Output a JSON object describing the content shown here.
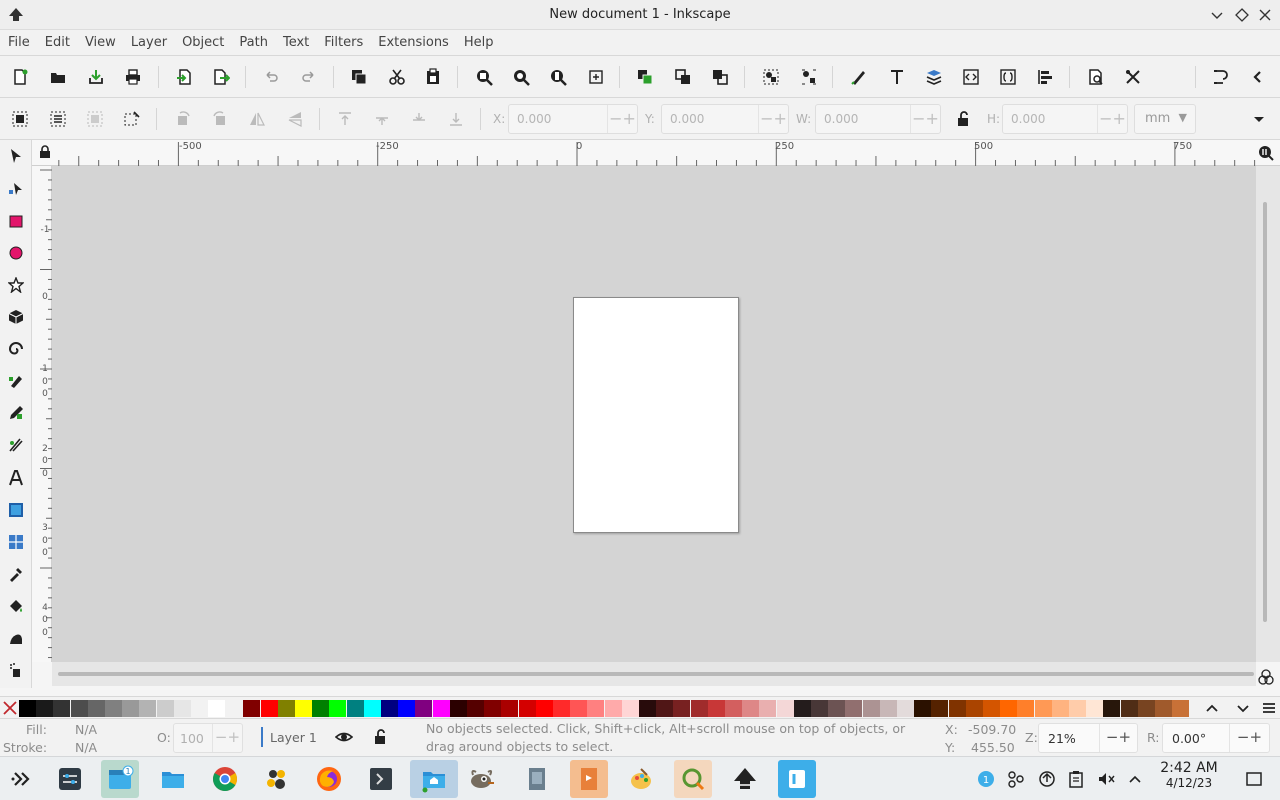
{
  "window": {
    "title": "New document 1 - Inkscape"
  },
  "menu": [
    "File",
    "Edit",
    "View",
    "Layer",
    "Object",
    "Path",
    "Text",
    "Filters",
    "Extensions",
    "Help"
  ],
  "select_toolbar": {
    "x_label": "X:",
    "x_value": "0.000",
    "y_label": "Y:",
    "y_value": "0.000",
    "w_label": "W:",
    "w_value": "0.000",
    "h_label": "H:",
    "h_value": "0.000",
    "unit": "mm"
  },
  "ruler": {
    "h_labels": [
      "-500",
      "-250",
      "0",
      "250",
      "500",
      "750"
    ],
    "v_labels": [
      "-1",
      "0",
      "1",
      "0",
      "0",
      "2",
      "0",
      "0",
      "3",
      "0",
      "0",
      "4",
      "0",
      "0"
    ]
  },
  "status": {
    "fill_label": "Fill:",
    "fill_value": "N/A",
    "stroke_label": "Stroke:",
    "stroke_value": "N/A",
    "opacity_label": "O:",
    "opacity_value": "100",
    "layer": "Layer 1",
    "message": "No objects selected. Click, Shift+click, Alt+scroll mouse on top of objects, or drag around objects to select.",
    "cursor_x_label": "X:",
    "cursor_x": "-509.70",
    "cursor_y_label": "Y:",
    "cursor_y": "455.50",
    "zoom_label": "Z:",
    "zoom": "21%",
    "rotation_label": "R:",
    "rotation": "0.00°"
  },
  "palette_colors": [
    "#000000",
    "#1a1a1a",
    "#333333",
    "#4d4d4d",
    "#666666",
    "#808080",
    "#999999",
    "#b3b3b3",
    "#cccccc",
    "#e6e6e6",
    "#f2f2f2",
    "#ffffff",
    "#800000",
    "#ff0000",
    "#808000",
    "#ffff00",
    "#008000",
    "#00ff00",
    "#008080",
    "#00ffff",
    "#000080",
    "#0000ff",
    "#800080",
    "#ff00ff",
    "#2b0000",
    "#550000",
    "#800000",
    "#aa0000",
    "#d40000",
    "#ff0000",
    "#ff2a2a",
    "#ff5555",
    "#ff8080",
    "#ffaaaa",
    "#ffd5d5",
    "#280b0b",
    "#501616",
    "#782121",
    "#a02c2c",
    "#c83737",
    "#d35f5f",
    "#de8787",
    "#e9afaf",
    "#f4d7d7",
    "#241c1c",
    "#483737",
    "#6c5353",
    "#916f6f",
    "#ac9393",
    "#c8b7b7",
    "#e3dbdb",
    "#2b1100",
    "#552200",
    "#803300",
    "#aa4400",
    "#d45500",
    "#ff6600",
    "#ff7f2a",
    "#ff9955",
    "#ffb380",
    "#ffccaa",
    "#ffe6d5",
    "#28170b",
    "#502d16",
    "#784421",
    "#a05a2c",
    "#c87137"
  ],
  "taskbar": {
    "clock_time": "2:42 AM",
    "clock_date": "4/12/23",
    "notification_badge": "1"
  }
}
